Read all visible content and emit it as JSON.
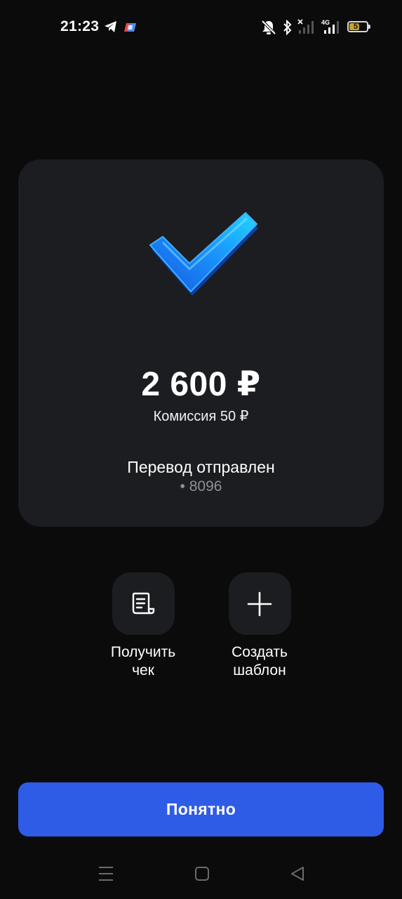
{
  "status_bar": {
    "time": "21:23",
    "battery_level": "57",
    "network_type": "4G",
    "icons": [
      "telegram-icon",
      "app-notification-icon",
      "silent-icon",
      "bluetooth-icon",
      "signal-icon",
      "signal-4g-icon",
      "battery-icon"
    ]
  },
  "result": {
    "icon": "check-icon",
    "amount": "2 600 ₽",
    "commission": "Комиссия 50 ₽",
    "title": "Перевод отправлен",
    "card_number": "• 8096"
  },
  "actions": [
    {
      "icon": "receipt-icon",
      "label_line1": "Получить",
      "label_line2": "чек"
    },
    {
      "icon": "plus-icon",
      "label_line1": "Создать",
      "label_line2": "шаблон"
    }
  ],
  "primary_button": {
    "label": "Понятно"
  },
  "nav_bar": {
    "icons": [
      "menu-icon",
      "home-icon",
      "back-icon"
    ]
  },
  "colors": {
    "background": "#0b0b0c",
    "card": "#1c1d21",
    "accent": "#2e5ce6",
    "check": "#1aa3ff",
    "muted_text": "#8e9098"
  }
}
